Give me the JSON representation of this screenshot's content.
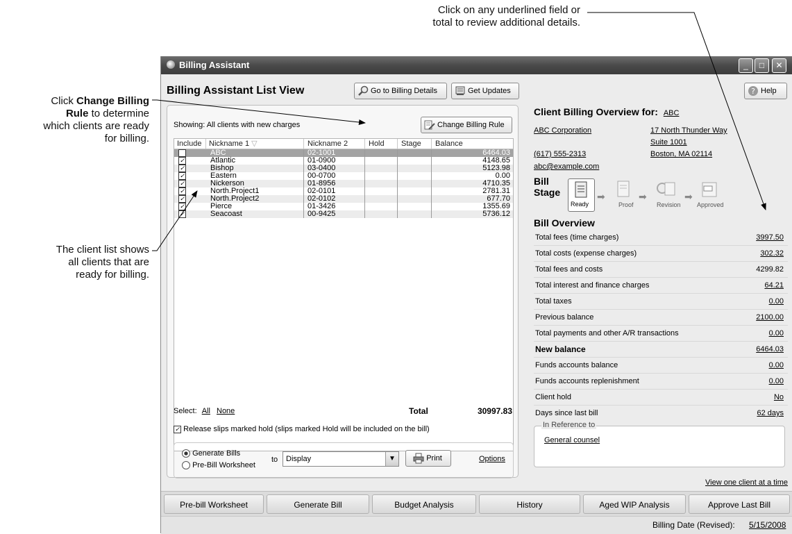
{
  "callouts": {
    "top": [
      "Click on any underlined field or",
      "total to review additional details."
    ],
    "change_rule": {
      "bold1": "Change Billing",
      "pre": "Click ",
      "bold2": "Rule",
      "rest": " to determine",
      "line3": "which clients are ready",
      "line4": "for billing."
    },
    "client_list": [
      "The client list shows",
      "all clients that are",
      "ready for billing."
    ]
  },
  "window": {
    "title": "Billing Assistant",
    "min": "_",
    "max": "□",
    "close": "✕"
  },
  "header": {
    "list_view_title": "Billing Assistant List View",
    "go_details": "Go to Billing Details",
    "get_updates": "Get Updates",
    "help": "Help"
  },
  "list": {
    "showing": "Showing:  All clients with new charges",
    "change_rule_btn": "Change Billing Rule",
    "columns": [
      "Include",
      "Nickname 1",
      "Nickname 2",
      "Hold",
      "Stage",
      "Balance"
    ],
    "rows": [
      {
        "nick1": "ABC",
        "nick2": "02-1001",
        "balance": "6464.03"
      },
      {
        "nick1": "Atlantic",
        "nick2": "01-0900",
        "balance": "4148.65"
      },
      {
        "nick1": "Bishop",
        "nick2": "03-0400",
        "balance": "5123.98"
      },
      {
        "nick1": "Eastern",
        "nick2": "00-0700",
        "balance": "0.00"
      },
      {
        "nick1": "Nickerson",
        "nick2": "01-8956",
        "balance": "4710.35"
      },
      {
        "nick1": "North.Project1",
        "nick2": "02-0101",
        "balance": "2781.31"
      },
      {
        "nick1": "North.Project2",
        "nick2": "02-0102",
        "balance": "677.70"
      },
      {
        "nick1": "Pierce",
        "nick2": "01-3426",
        "balance": "1355.69"
      },
      {
        "nick1": "Seacoast",
        "nick2": "00-9425",
        "balance": "5736.12"
      }
    ],
    "select_label": "Select:",
    "select_all": "All",
    "select_none": "None",
    "total_label": "Total",
    "total_value": "30997.83",
    "release_label": "Release slips marked hold (slips marked Hold will be included on the bill)",
    "gen_bills": "Generate Bills",
    "pre_bill": "Pre-Bill Worksheet",
    "to_label": "to",
    "to_value": "Display",
    "print": "Print",
    "options": "Options"
  },
  "overview": {
    "title": "Client Billing Overview for:",
    "client": "ABC",
    "corp": "ABC Corporation",
    "addr1": "17 North Thunder Way",
    "addr2": "Suite 1001",
    "phone": "(617) 555-2313",
    "city": "Boston, MA 02114",
    "email": "abc@example.com",
    "bill_label": "Bill",
    "stage_label": "Stage",
    "stages": [
      "Ready",
      "Proof",
      "Revision",
      "Approved"
    ],
    "bill_overview": "Bill Overview",
    "rows": [
      {
        "label": "Total fees (time charges)",
        "value": "3997.50",
        "link": true
      },
      {
        "label": "Total costs (expense charges)",
        "value": "302.32",
        "link": true
      },
      {
        "label": "Total fees and costs",
        "value": "4299.82",
        "link": false
      },
      {
        "label": "Total interest and finance charges",
        "value": "64.21",
        "link": true
      },
      {
        "label": "Total taxes",
        "value": "0.00",
        "link": true
      },
      {
        "label": "Previous balance",
        "value": "2100.00",
        "link": true
      },
      {
        "label": "Total payments and other A/R transactions",
        "value": "0.00",
        "link": true
      },
      {
        "label": "New balance",
        "value": "6464.03",
        "link": true,
        "bold": true
      },
      {
        "label": "Funds accounts balance",
        "value": "0.00",
        "link": true
      },
      {
        "label": "Funds accounts replenishment",
        "value": "0.00",
        "link": true
      },
      {
        "label": "Client hold",
        "value": "No",
        "link": true
      },
      {
        "label": "Days since last bill",
        "value": "62 days",
        "link": true
      }
    ],
    "in_reference": "In Reference to",
    "reference_value": "General counsel",
    "view_one": "View one client at a time"
  },
  "tabs": [
    "Pre-bill Worksheet",
    "Generate Bill",
    "Budget Analysis",
    "History",
    "Aged WIP Analysis",
    "Approve Last Bill"
  ],
  "status": {
    "label": "Billing Date (Revised):",
    "value": "5/15/2008"
  }
}
